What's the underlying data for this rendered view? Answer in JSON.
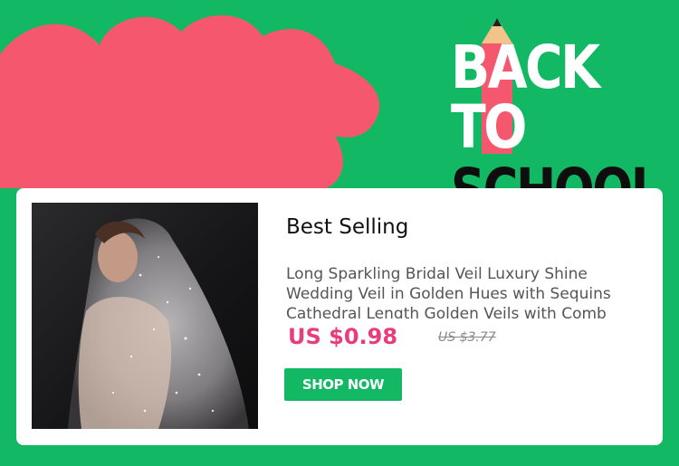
{
  "banner": {
    "headline_line1": "BACK TO",
    "headline_line2": "SCHOOL",
    "colors": {
      "background": "#12b863",
      "accent_pink": "#f5586e",
      "pencil_tip": "#f3c489"
    },
    "icons": [
      "pencil-icon"
    ]
  },
  "product": {
    "section_title": "Best Selling",
    "description": "Long Sparkling Bridal Veil Luxury Shine Wedding Veil in Golden Hues with Sequins Cathedral Length Golden Veils with Comb",
    "price": "US $0.98",
    "original_price": "US $3.77",
    "button_label": "SHOP NOW",
    "colors": {
      "price": "#e83d7b",
      "button": "#12b863"
    }
  }
}
